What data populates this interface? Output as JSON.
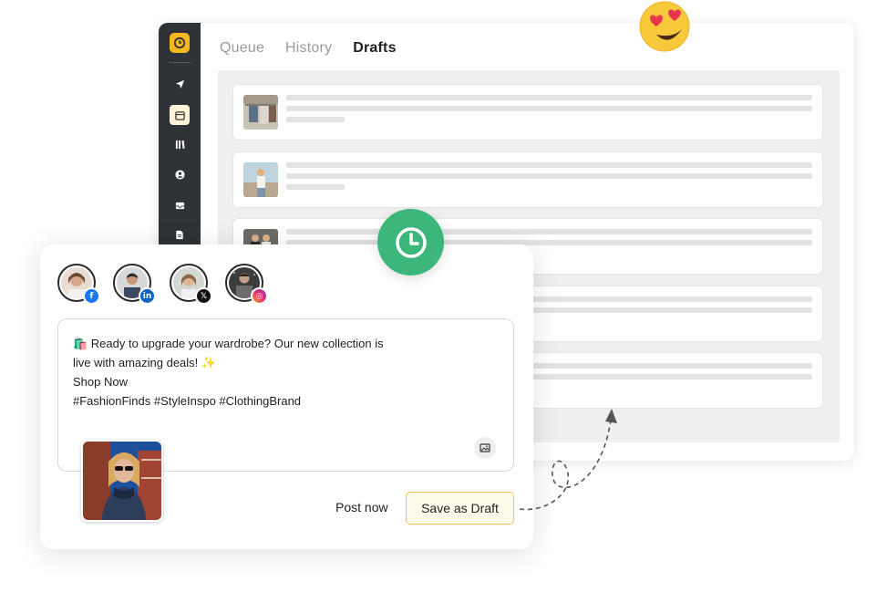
{
  "tabs": [
    {
      "label": "Queue",
      "active": false
    },
    {
      "label": "History",
      "active": false
    },
    {
      "label": "Drafts",
      "active": true
    }
  ],
  "sidebar": {
    "icons": [
      "send-icon",
      "calendar-icon",
      "library-icon",
      "user-icon",
      "inbox-icon",
      "document-icon"
    ],
    "active_index": 1
  },
  "drafts": {
    "row_count": 5
  },
  "accounts": [
    {
      "network": "facebook",
      "badge": "f",
      "color": "#1877f2"
    },
    {
      "network": "linkedin",
      "badge": "in",
      "color": "#0a66c2"
    },
    {
      "network": "x",
      "badge": "𝕏",
      "color": "#111111"
    },
    {
      "network": "instagram",
      "badge": "◎",
      "color": "#d6249f"
    }
  ],
  "post": {
    "lines": [
      "🛍️ Ready to upgrade your wardrobe? Our new collection is",
      "live with amazing deals! ✨",
      "Shop Now",
      "#FashionFinds #StyleInspo #ClothingBrand"
    ]
  },
  "actions": {
    "post_now": "Post now",
    "save_draft": "Save as Draft"
  },
  "colors": {
    "accent": "#f6b81e",
    "clock_green": "#3db67c",
    "sidebar": "#2f3337",
    "draft_button_border": "#f6c54b"
  }
}
